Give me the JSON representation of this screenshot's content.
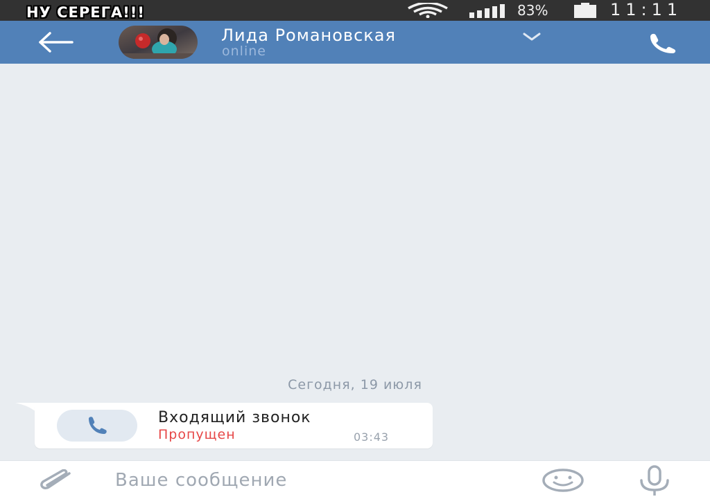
{
  "overlay": {
    "caption": "НУ СЕРЕГА!!!"
  },
  "status_bar": {
    "battery_percent": "83%",
    "time": "11:11",
    "wifi_icon": "wifi-icon",
    "signal_icon": "signal-icon",
    "battery_icon": "battery-icon"
  },
  "header": {
    "back_icon": "arrow-left-icon",
    "contact_name": "Лида Романовская",
    "contact_status": "online",
    "dropdown_icon": "chevron-down-icon",
    "call_icon": "phone-icon",
    "color": "#5181b8"
  },
  "messages": {
    "date_separator": "Сегодня, 19 июля",
    "items": [
      {
        "type": "call",
        "title": "Входящий звонок",
        "status": "Пропущен",
        "time": "03:43",
        "icon": "phone-icon",
        "status_color": "#e64646"
      }
    ]
  },
  "composer": {
    "placeholder": "Ваше сообщение",
    "attach_icon": "paperclip-icon",
    "emoji_icon": "smiley-icon",
    "mic_icon": "microphone-icon"
  }
}
